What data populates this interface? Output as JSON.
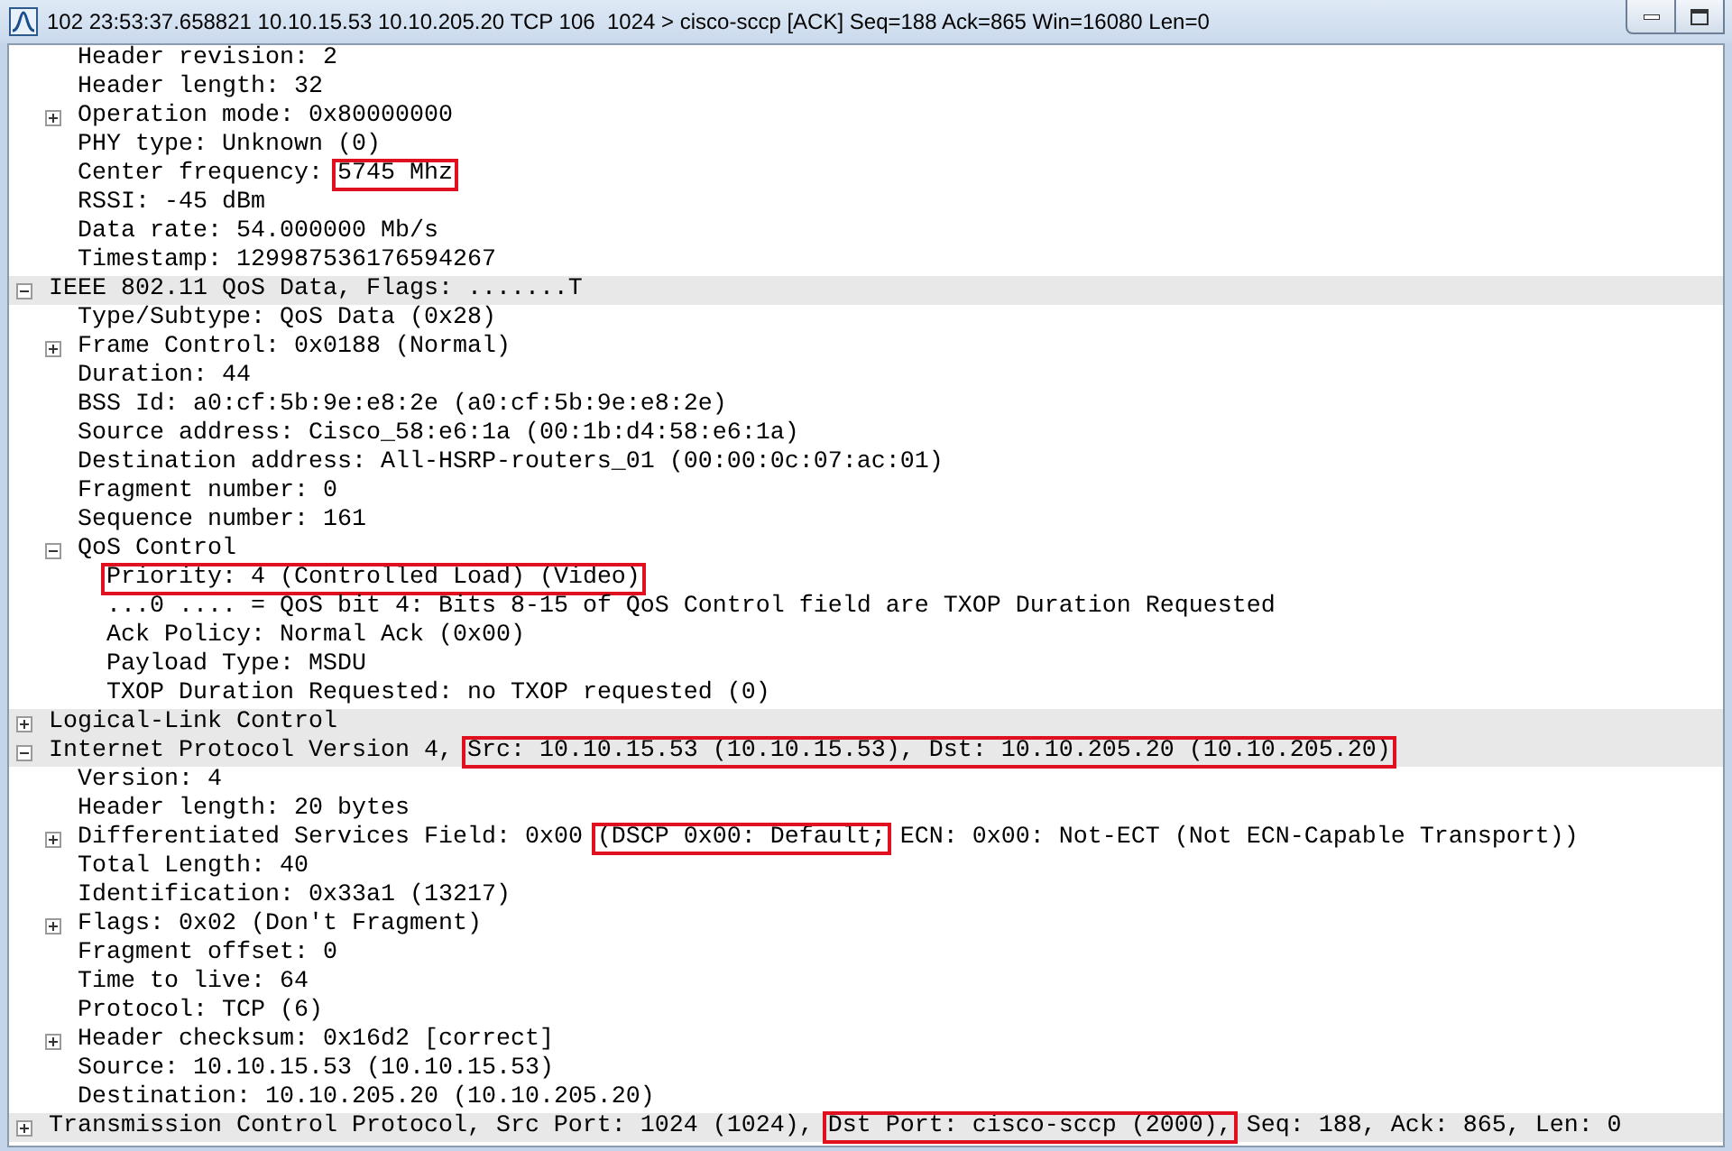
{
  "window": {
    "title": "102 23:53:37.658821 10.10.15.53 10.10.205.20 TCP 106  1024 > cisco-sccp [ACK] Seq=188 Ack=865 Win=16080 Len=0"
  },
  "tree": [
    {
      "children": [
        {
          "text": "Header revision: 2"
        },
        {
          "text": "Header length: 32"
        },
        {
          "text": "Operation mode: 0x80000000",
          "expanded": false
        },
        {
          "text": "PHY type: Unknown (0)"
        },
        {
          "parts": [
            {
              "text": "Center frequency: ",
              "boxed": false
            },
            {
              "text": "5745 Mhz",
              "boxed": true
            }
          ]
        },
        {
          "text": "RSSI: -45 dBm"
        },
        {
          "text": "Data rate: 54.000000 Mb/s"
        },
        {
          "text": "Timestamp: 129987536176594267"
        }
      ]
    },
    {
      "text": "IEEE 802.11 QoS Data, Flags: .......T",
      "expanded": true,
      "children": [
        {
          "text": "Type/Subtype: QoS Data (0x28)"
        },
        {
          "text": "Frame Control: 0x0188 (Normal)",
          "expanded": false
        },
        {
          "text": "Duration: 44"
        },
        {
          "text": "BSS Id: a0:cf:5b:9e:e8:2e (a0:cf:5b:9e:e8:2e)"
        },
        {
          "text": "Source address: Cisco_58:e6:1a (00:1b:d4:58:e6:1a)"
        },
        {
          "text": "Destination address: All-HSRP-routers_01 (00:00:0c:07:ac:01)"
        },
        {
          "text": "Fragment number: 0"
        },
        {
          "text": "Sequence number: 161"
        },
        {
          "text": "QoS Control",
          "expanded": true,
          "children": [
            {
              "parts": [
                {
                  "text": "Priority: 4 (Controlled Load) (Video)",
                  "boxed": true
                }
              ]
            },
            {
              "text": "...0 .... = QoS bit 4: Bits 8-15 of QoS Control field are TXOP Duration Requested"
            },
            {
              "text": "Ack Policy: Normal Ack (0x00)"
            },
            {
              "text": "Payload Type: MSDU"
            },
            {
              "text": "TXOP Duration Requested: no TXOP requested (0)"
            }
          ]
        }
      ]
    },
    {
      "text": "Logical-Link Control",
      "expanded": false
    },
    {
      "parts": [
        {
          "text": "Internet Protocol Version 4, ",
          "boxed": false
        },
        {
          "text": "Src: 10.10.15.53 (10.10.15.53), Dst: 10.10.205.20 (10.10.205.20)",
          "boxed": true
        }
      ],
      "expanded": true,
      "children": [
        {
          "text": "Version: 4"
        },
        {
          "text": "Header length: 20 bytes"
        },
        {
          "parts": [
            {
              "text": "Differentiated Services Field: 0x00 ",
              "boxed": false
            },
            {
              "text": "(DSCP 0x00: Default;",
              "boxed": true
            },
            {
              "text": " ECN: 0x00: Not-ECT (Not ECN-Capable Transport))",
              "boxed": false
            }
          ],
          "expanded": false
        },
        {
          "text": "Total Length: 40"
        },
        {
          "text": "Identification: 0x33a1 (13217)"
        },
        {
          "text": "Flags: 0x02 (Don't Fragment)",
          "expanded": false
        },
        {
          "text": "Fragment offset: 0"
        },
        {
          "text": "Time to live: 64"
        },
        {
          "text": "Protocol: TCP (6)"
        },
        {
          "text": "Header checksum: 0x16d2 [correct]",
          "expanded": false
        },
        {
          "text": "Source: 10.10.15.53 (10.10.15.53)"
        },
        {
          "text": "Destination: 10.10.205.20 (10.10.205.20)"
        }
      ]
    },
    {
      "parts": [
        {
          "text": "Transmission Control Protocol, Src Port: 1024 (1024), ",
          "boxed": false
        },
        {
          "text": "Dst Port: cisco-sccp (2000),",
          "boxed": true
        },
        {
          "text": " Seq: 188, Ack: 865, Len: 0",
          "boxed": false
        }
      ],
      "expanded": false
    }
  ]
}
